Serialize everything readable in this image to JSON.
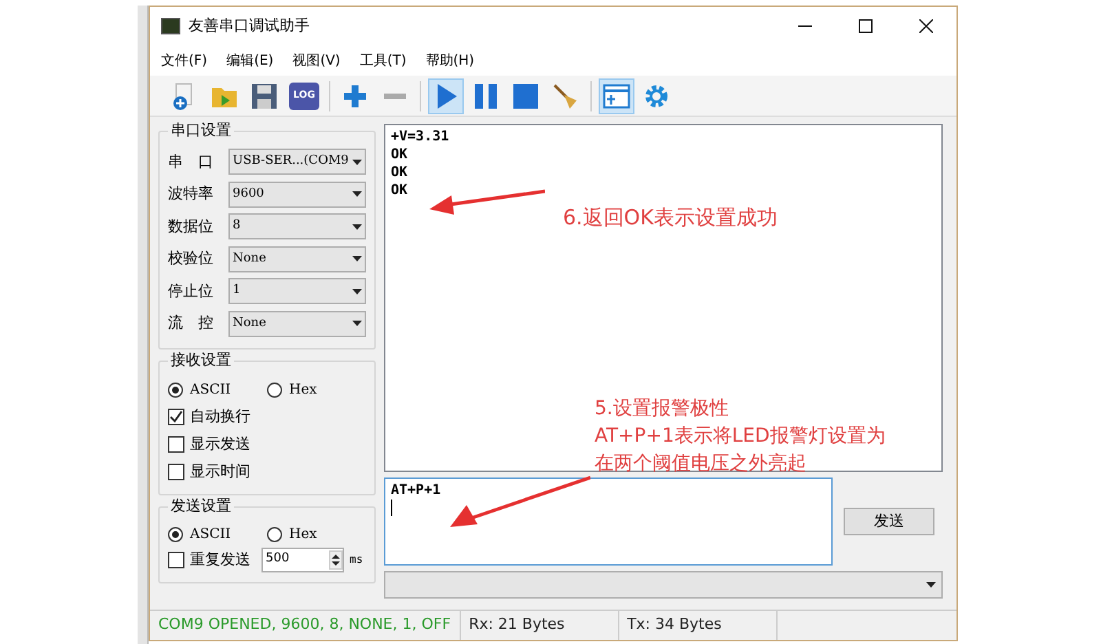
{
  "window": {
    "title": "友善串口调试助手"
  },
  "menu": [
    "文件(F)",
    "编辑(E)",
    "视图(V)",
    "工具(T)",
    "帮助(H)"
  ],
  "toolbar": [
    {
      "kind": "new",
      "selected": false
    },
    {
      "kind": "open",
      "selected": false
    },
    {
      "kind": "save",
      "selected": false
    },
    {
      "kind": "log",
      "label": "LOG",
      "selected": false
    },
    {
      "kind": "sep"
    },
    {
      "kind": "plus",
      "selected": false
    },
    {
      "kind": "minus",
      "selected": false
    },
    {
      "kind": "sep"
    },
    {
      "kind": "play",
      "selected": true
    },
    {
      "kind": "pause",
      "selected": false
    },
    {
      "kind": "stop",
      "selected": false
    },
    {
      "kind": "broom",
      "selected": false
    },
    {
      "kind": "sep"
    },
    {
      "kind": "panel",
      "selected": true
    },
    {
      "kind": "gear",
      "selected": false
    }
  ],
  "port_settings": {
    "title": "串口设置",
    "fields": [
      {
        "label": "串　口",
        "value": "USB-SER...(COM9"
      },
      {
        "label": "波特率",
        "value": "9600"
      },
      {
        "label": "数据位",
        "value": "8"
      },
      {
        "label": "校验位",
        "value": "None"
      },
      {
        "label": "停止位",
        "value": "1"
      },
      {
        "label": "流　控",
        "value": "None"
      }
    ]
  },
  "receive_settings": {
    "title": "接收设置",
    "modes": [
      {
        "label": "ASCII",
        "selected": true
      },
      {
        "label": "Hex",
        "selected": false
      }
    ],
    "options": [
      {
        "label": "自动换行",
        "checked": true
      },
      {
        "label": "显示发送",
        "checked": false
      },
      {
        "label": "显示时间",
        "checked": false
      }
    ]
  },
  "send_settings": {
    "title": "发送设置",
    "modes": [
      {
        "label": "ASCII",
        "selected": true
      },
      {
        "label": "Hex",
        "selected": false
      }
    ],
    "repeat": {
      "label": "重复发送",
      "checked": false,
      "value": "500",
      "unit": "ms"
    }
  },
  "receive_log": [
    "+V=3.31",
    "OK",
    "OK",
    "OK"
  ],
  "send_input": {
    "value": "AT+P+1"
  },
  "send_button": "发送",
  "status_bar": [
    "COM9 OPENED, 9600, 8, NONE, 1, OFF",
    "Rx: 21 Bytes",
    "Tx: 34 Bytes"
  ],
  "annotations": [
    {
      "lines": [
        "6.返回OK表示设置成功"
      ]
    },
    {
      "lines": [
        "5.设置报警极性",
        "AT+P+1表示将LED报警灯设置为",
        "在两个阈值电压之外亮起"
      ]
    }
  ]
}
